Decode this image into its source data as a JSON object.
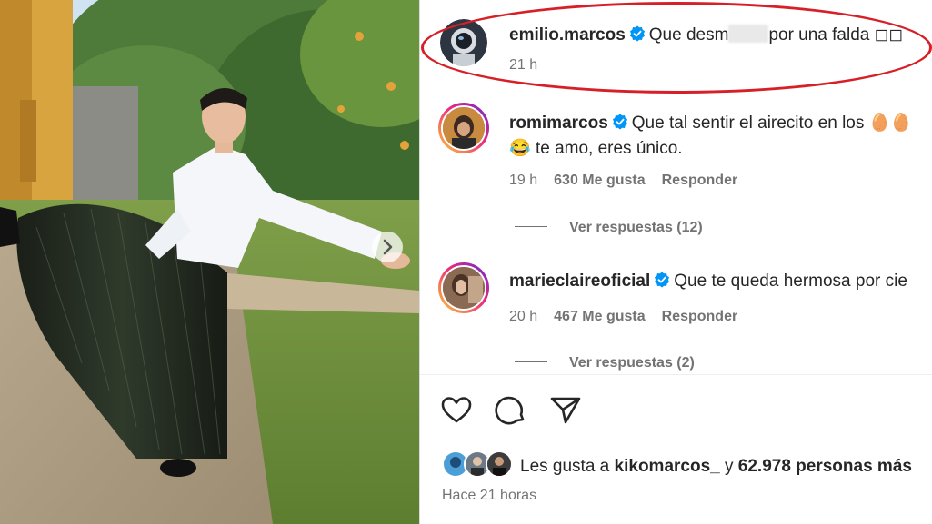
{
  "post_image": {
    "alt_description_hidden": ""
  },
  "caption": {
    "username": "emilio.marcos",
    "text_before": "Que desm",
    "text_after": "por una falda ",
    "emoji": "◻◻",
    "time": "21 h"
  },
  "comments": [
    {
      "username": "romimarcos",
      "text_line1": "Que tal sentir el airecito en los ",
      "line1_emoji": "🥚🥚",
      "line2_emoji": "😂",
      "text_line2": " te amo, eres único.",
      "time": "19 h",
      "likes": "630 Me gusta",
      "reply_label": "Responder",
      "view_replies": "Ver respuestas (12)"
    },
    {
      "username": "marieclaireoficial",
      "text_line1": "Que te queda hermosa por cie",
      "time": "20 h",
      "likes": "467 Me gusta",
      "reply_label": "Responder",
      "view_replies": "Ver respuestas (2)"
    }
  ],
  "actions": {
    "like_icon": "heart-icon",
    "comment_icon": "comment-icon",
    "share_icon": "share-icon"
  },
  "likes_summary": {
    "prefix": "Les gusta a ",
    "user": "kikomarcos_",
    "middle": " y ",
    "count": "62.978 personas más"
  },
  "posted_ago": "Hace 21 horas",
  "colors": {
    "highlight": "#d61f26",
    "verified": "#0095f6",
    "text": "#262626",
    "muted": "#737373"
  }
}
